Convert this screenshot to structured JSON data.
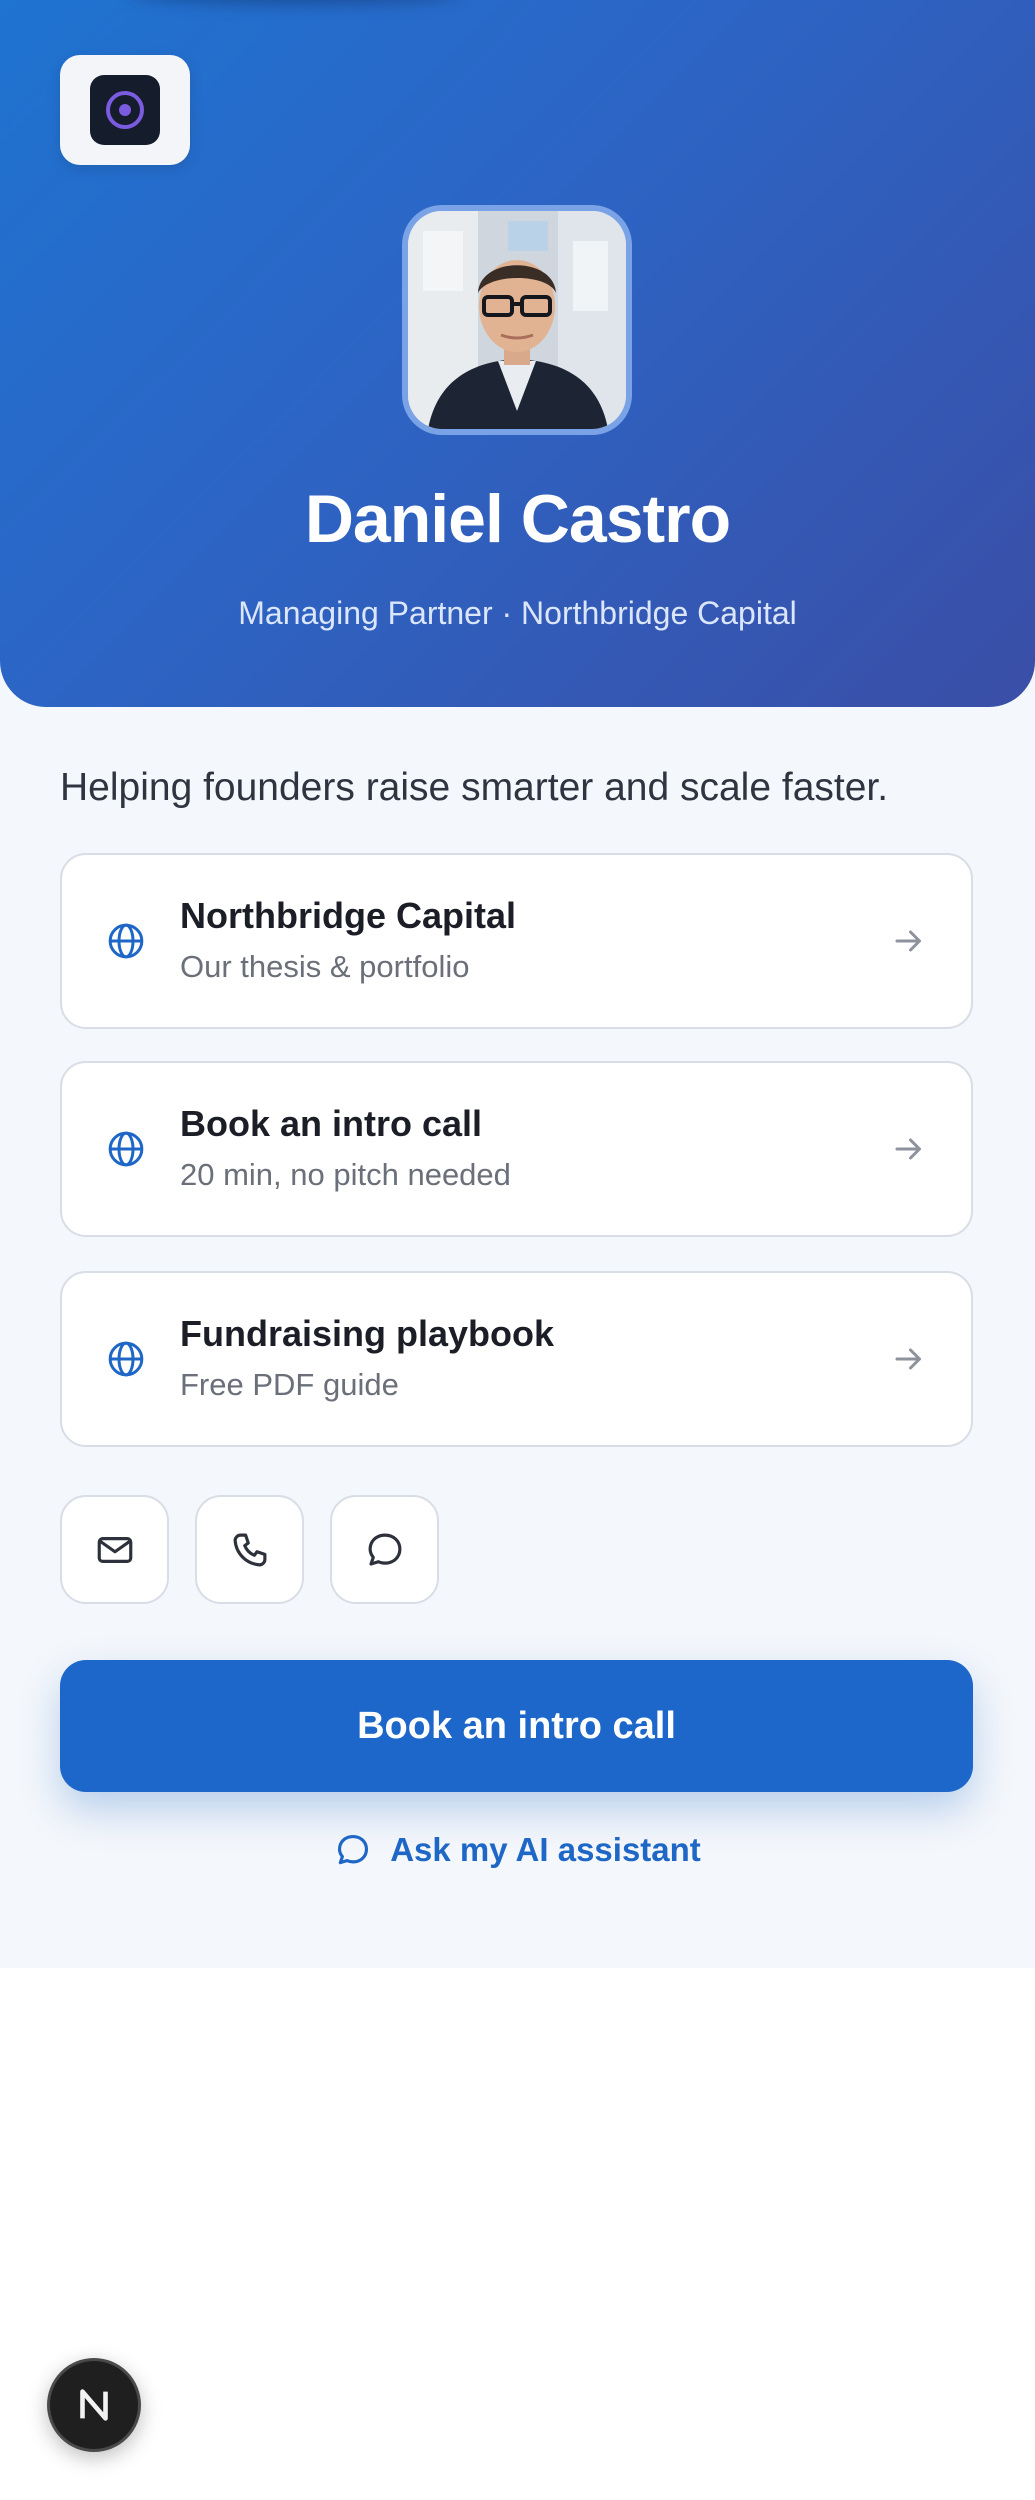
{
  "profile": {
    "name": "Daniel Castro",
    "subtitle": "Managing Partner · Northbridge Capital",
    "tagline": "Helping founders raise smarter and scale faster."
  },
  "links": [
    {
      "title": "Northbridge Capital",
      "subtitle": "Our thesis & portfolio",
      "icon": "globe-icon"
    },
    {
      "title": "Book an intro call",
      "subtitle": "20 min, no pitch needed",
      "icon": "globe-icon"
    },
    {
      "title": "Fundraising playbook",
      "subtitle": "Free PDF guide",
      "icon": "globe-icon"
    }
  ],
  "contact_icons": [
    "mail-icon",
    "phone-icon",
    "chat-icon"
  ],
  "cta": {
    "label": "Book an intro call"
  },
  "assistant": {
    "label": "Ask my AI assistant",
    "icon": "chat-icon"
  },
  "fab": {
    "label": "N"
  },
  "colors": {
    "hero_start": "#1f73d1",
    "hero_end": "#3a4ea6",
    "accent": "#1c67c9",
    "page_bg": "#f4f7fb"
  }
}
